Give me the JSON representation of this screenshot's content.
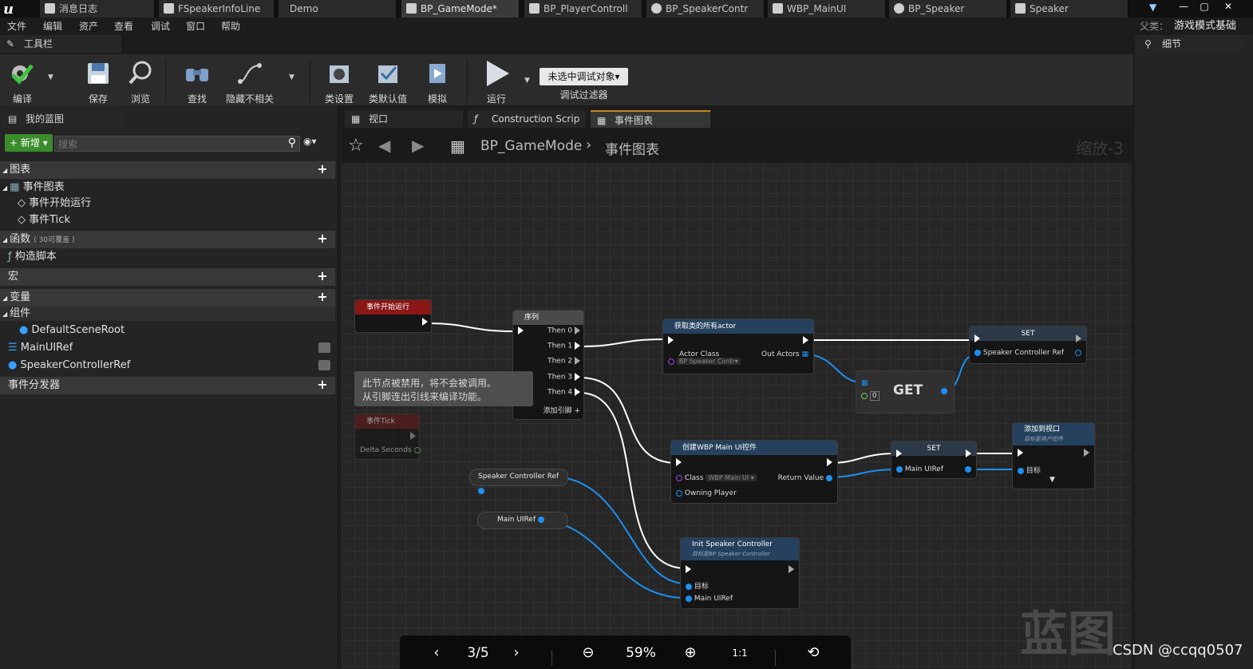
{
  "title_tabs": [
    {
      "label": "消息日志"
    },
    {
      "label": "FSpeakerInfoLine"
    },
    {
      "label": "Demo"
    },
    {
      "label": "BP_GameMode*"
    },
    {
      "label": "BP_PlayerControll"
    },
    {
      "label": "BP_SpeakerContr"
    },
    {
      "label": "WBP_MainUI"
    },
    {
      "label": "BP_Speaker"
    },
    {
      "label": "Speaker"
    }
  ],
  "window_controls": [
    "—",
    "▢",
    "✕"
  ],
  "menu": [
    "文件",
    "编辑",
    "资产",
    "查看",
    "调试",
    "窗口",
    "帮助"
  ],
  "parent_class_label": "父类：",
  "parent_class_value": "游戏模式基础",
  "toolbar_panel_title": "工具栏",
  "details_panel_title": "细节",
  "toolbar": {
    "compile": "编译",
    "save": "保存",
    "browse": "浏览",
    "find": "查找",
    "hide_unrelated": "隐藏不相关",
    "class_settings": "类设置",
    "class_defaults": "类默认值",
    "simulate": "模拟",
    "run": "运行",
    "debug_select": "未选中调试对象▾",
    "debug_filter": "调试过滤器"
  },
  "my_blueprint": {
    "title": "我的蓝图",
    "new_button": "新增",
    "search_placeholder": "搜索",
    "graphs_cat": "图表",
    "event_graph": "事件图表",
    "event_begin_play": "事件开始运行",
    "event_tick": "事件Tick",
    "functions_cat": "函数",
    "functions_note": "( 30可覆盖 )",
    "construction_script": "构造脚本",
    "macros_cat": "宏",
    "variables_cat": "变量",
    "components_cat": "组件",
    "default_scene_root": "DefaultSceneRoot",
    "var_main_ui_ref": "MainUIRef",
    "var_speaker_controller_ref": "SpeakerControllerRef",
    "event_dispatchers_cat": "事件分发器"
  },
  "graph_tabs": [
    {
      "label": "视口"
    },
    {
      "label": "Construction Scrip"
    },
    {
      "label": "事件图表"
    }
  ],
  "breadcrumb": {
    "root": "BP_GameMode",
    "sep": "›",
    "current": "事件图表"
  },
  "zoom_label": "缩放-3",
  "watermark": "蓝图",
  "nodes": {
    "begin_play": {
      "title": "事件开始运行"
    },
    "sequence": {
      "title": "序列",
      "pins": [
        "Then 0",
        "Then 1",
        "Then 2",
        "Then 3",
        "Then 4"
      ],
      "add_pin": "添加引脚"
    },
    "disabled_comment": {
      "line1": "此节点被禁用，将不会被调用。",
      "line2": "从引脚连出引线来编译功能。"
    },
    "event_tick": {
      "title": "事件Tick",
      "pin": "Delta Seconds"
    },
    "get_all_actors": {
      "title": "获取类的所有actor",
      "actor_class": "Actor Class",
      "class_value": "BP Speaker Contr▾",
      "out": "Out Actors"
    },
    "get": {
      "title": "GET",
      "index": "0"
    },
    "set_speaker": {
      "title": "SET",
      "pin": "Speaker Controller Ref"
    },
    "create_widget": {
      "title": "创建WBP Main UI控件",
      "class": "Class",
      "class_value": "WBP Main UI ▾",
      "return": "Return Value",
      "owner": "Owning Player"
    },
    "set_main": {
      "title": "SET",
      "pin": "Main UIRef"
    },
    "add_viewport": {
      "title": "添加到视口",
      "subtitle": "目标是用户控件",
      "target": "目标"
    },
    "speaker_ref_var": {
      "label": "Speaker Controller Ref"
    },
    "main_ref_var": {
      "label": "Main UIRef"
    },
    "init_speaker": {
      "title": "Init Speaker Controller",
      "subtitle": "目标是BP Speaker Controller",
      "target": "目标",
      "pin": "Main UIRef"
    }
  },
  "viewer": {
    "page": "3/5",
    "zoom": "59%"
  },
  "credit": "CSDN @ccqq0507",
  "colors": {
    "accent_exec": "#ffffff",
    "object_pin": "#1e8ff0",
    "class_pin": "#9b4ae8",
    "event_header": "#8a1616",
    "function_header": "#25415e"
  }
}
